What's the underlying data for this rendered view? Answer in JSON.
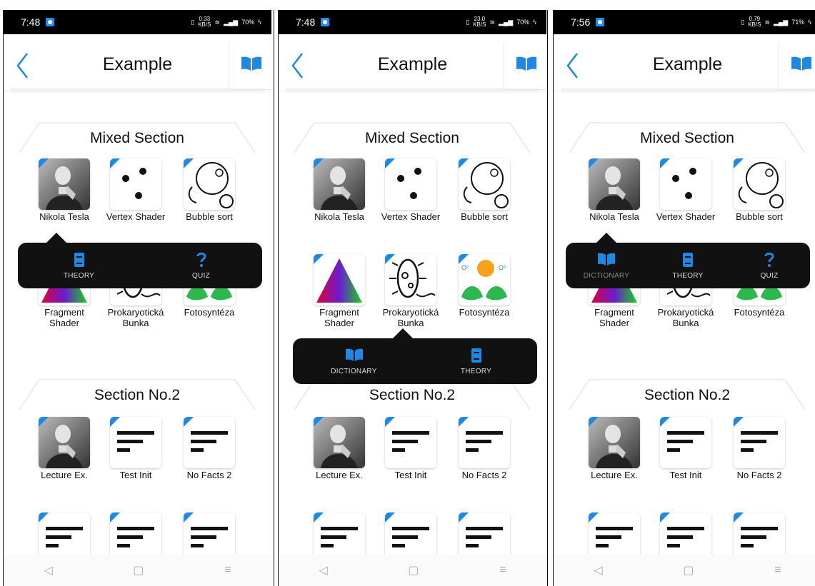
{
  "phones": [
    {
      "time": "7:48",
      "speed": "0.33",
      "speed_unit": "KB/S",
      "battery": "70%",
      "header_title": "Example",
      "sections": [
        "Mixed Section",
        "Section No.2"
      ],
      "popup": {
        "items": [
          "THEORY",
          "QUIZ"
        ]
      }
    },
    {
      "time": "7:48",
      "speed": "23.0",
      "speed_unit": "KB/S",
      "battery": "70%",
      "header_title": "Example",
      "sections": [
        "Mixed Section",
        "Section No.2"
      ],
      "popup": {
        "items": [
          "DICTIONARY",
          "THEORY"
        ]
      }
    },
    {
      "time": "7:56",
      "speed": "0.79",
      "speed_unit": "KB/S",
      "battery": "71%",
      "header_title": "Example",
      "sections": [
        "Mixed Section",
        "Section No.2"
      ],
      "popup": {
        "items": [
          "DICTIONARY",
          "THEORY",
          "QUIZ"
        ]
      }
    }
  ],
  "tiles": {
    "nikola": "Nikola Tesla",
    "vertex": "Vertex Shader",
    "bubble": "Bubble sort",
    "fragment": "Fragment Shader",
    "prokaryot": "Prokaryotická Bunka",
    "foto": "Fotosyntéza",
    "lecture": "Lecture Ex.",
    "testinit": "Test Init",
    "nofacts": "No Facts 2"
  },
  "colors": {
    "accent": "#1e88e5",
    "popup_bg": "#111111",
    "status_bg": "#000000"
  },
  "icons": [
    "back-chevron-icon",
    "book-open-icon",
    "book-icon",
    "question-icon",
    "text-lines-icon"
  ]
}
